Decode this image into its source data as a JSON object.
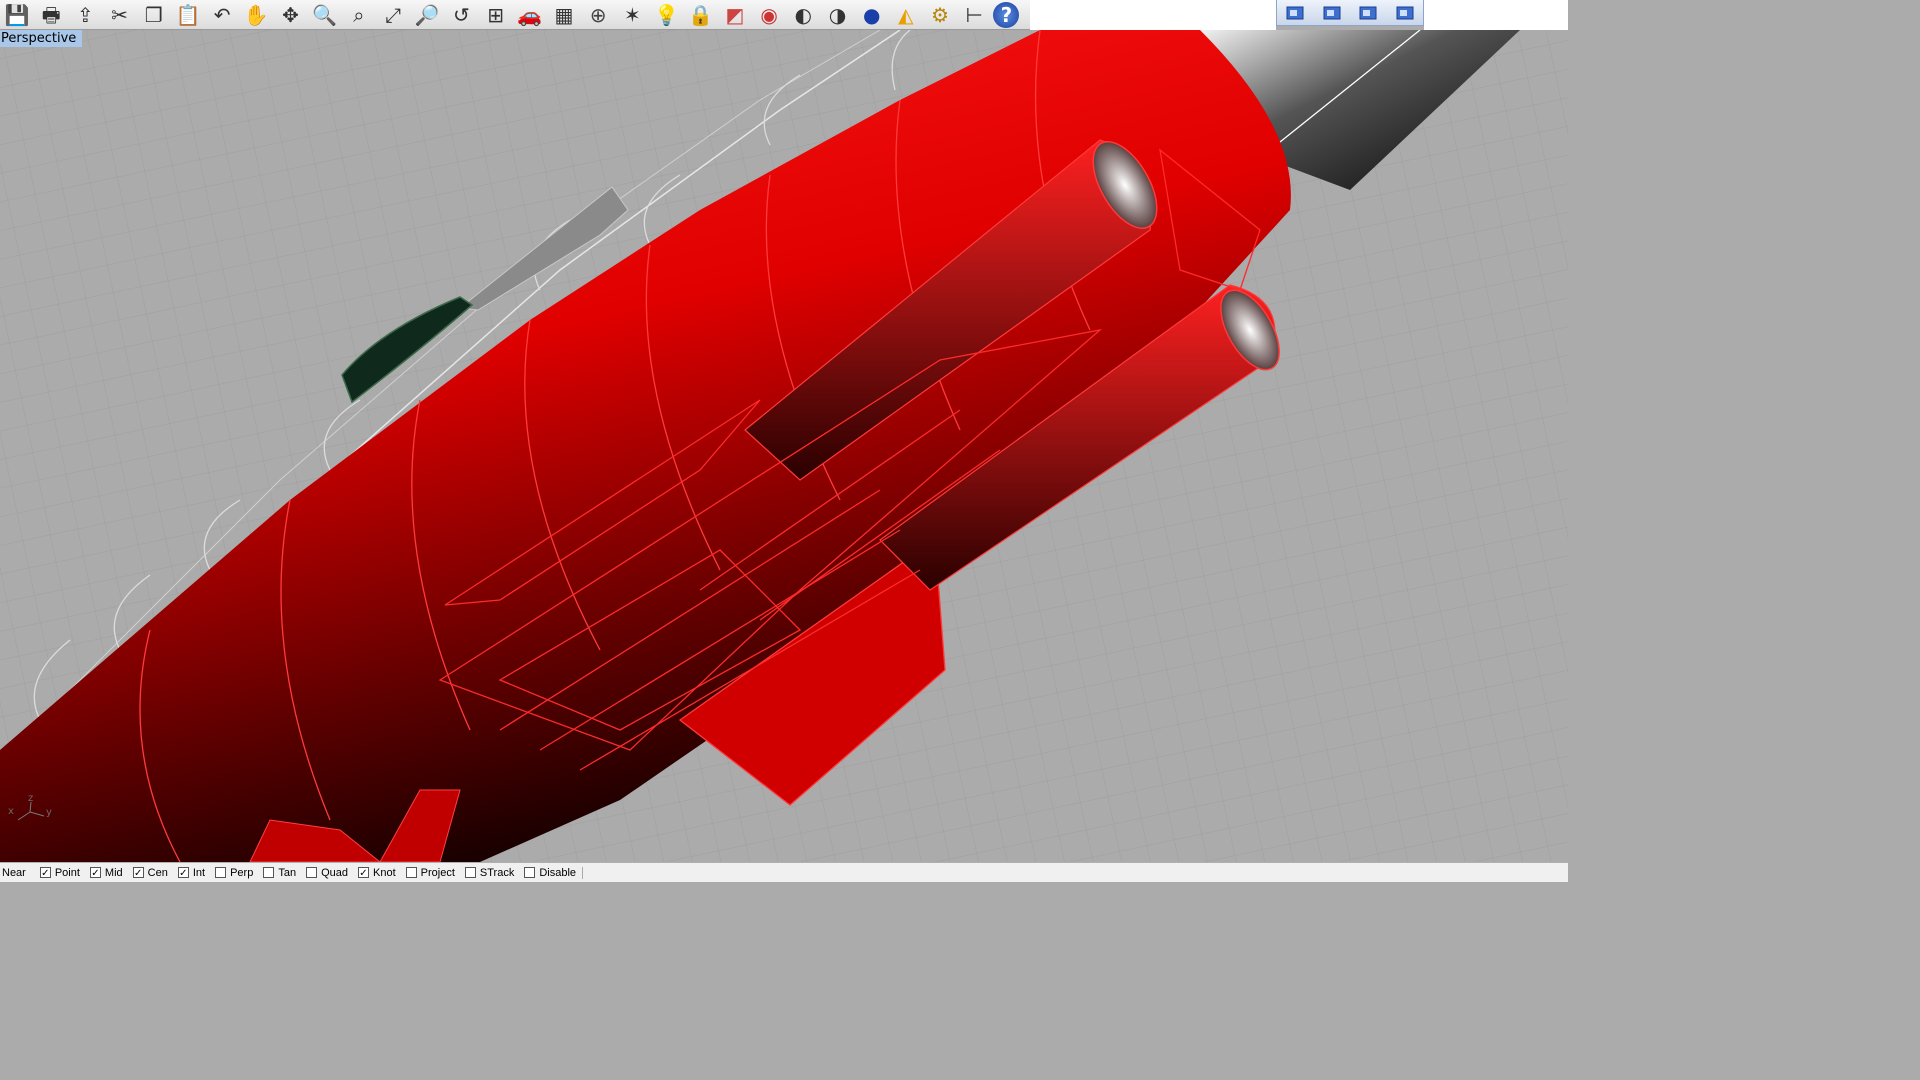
{
  "toolbar": {
    "icons": [
      "save-icon",
      "print-icon",
      "export-icon",
      "cut-icon",
      "copy-icon",
      "paste-icon",
      "undo-icon",
      "pan-hand-icon",
      "rotate-view-icon",
      "zoom-in-icon",
      "zoom-window-icon",
      "zoom-extents-icon",
      "zoom-selected-icon",
      "undo-view-icon",
      "four-viewports-icon",
      "car-named-view-icon",
      "grid-plane-icon",
      "osnap-icon",
      "gumball-icon",
      "light-icon",
      "lock-icon",
      "layer-icon",
      "color-wheel-icon",
      "wireframe-sphere-icon",
      "shaded-sphere-icon",
      "rendered-sphere-icon",
      "render-icon",
      "options-gear-icon",
      "dimension-icon",
      "help-icon"
    ]
  },
  "viewport_buttons": [
    "perspective-view-icon",
    "top-view-icon",
    "front-view-icon",
    "right-view-icon"
  ],
  "viewport": {
    "label": "Perspective",
    "axes": {
      "x": "x",
      "y": "y",
      "z": "z"
    },
    "colors": {
      "model": "#e60000",
      "grid_bg": "#ababab",
      "label_bg": "#a9c7e8",
      "nose": "#1a1a1a",
      "canopy": "#0f2a1c"
    }
  },
  "statusbar": {
    "osnap_label": "Near",
    "snaps": [
      {
        "label": "Point",
        "checked": true
      },
      {
        "label": "Mid",
        "checked": true
      },
      {
        "label": "Cen",
        "checked": true
      },
      {
        "label": "Int",
        "checked": true
      },
      {
        "label": "Perp",
        "checked": false
      },
      {
        "label": "Tan",
        "checked": false
      },
      {
        "label": "Quad",
        "checked": false
      },
      {
        "label": "Knot",
        "checked": true
      },
      {
        "label": "Project",
        "checked": false
      },
      {
        "label": "STrack",
        "checked": false
      },
      {
        "label": "Disable",
        "checked": false
      }
    ]
  }
}
